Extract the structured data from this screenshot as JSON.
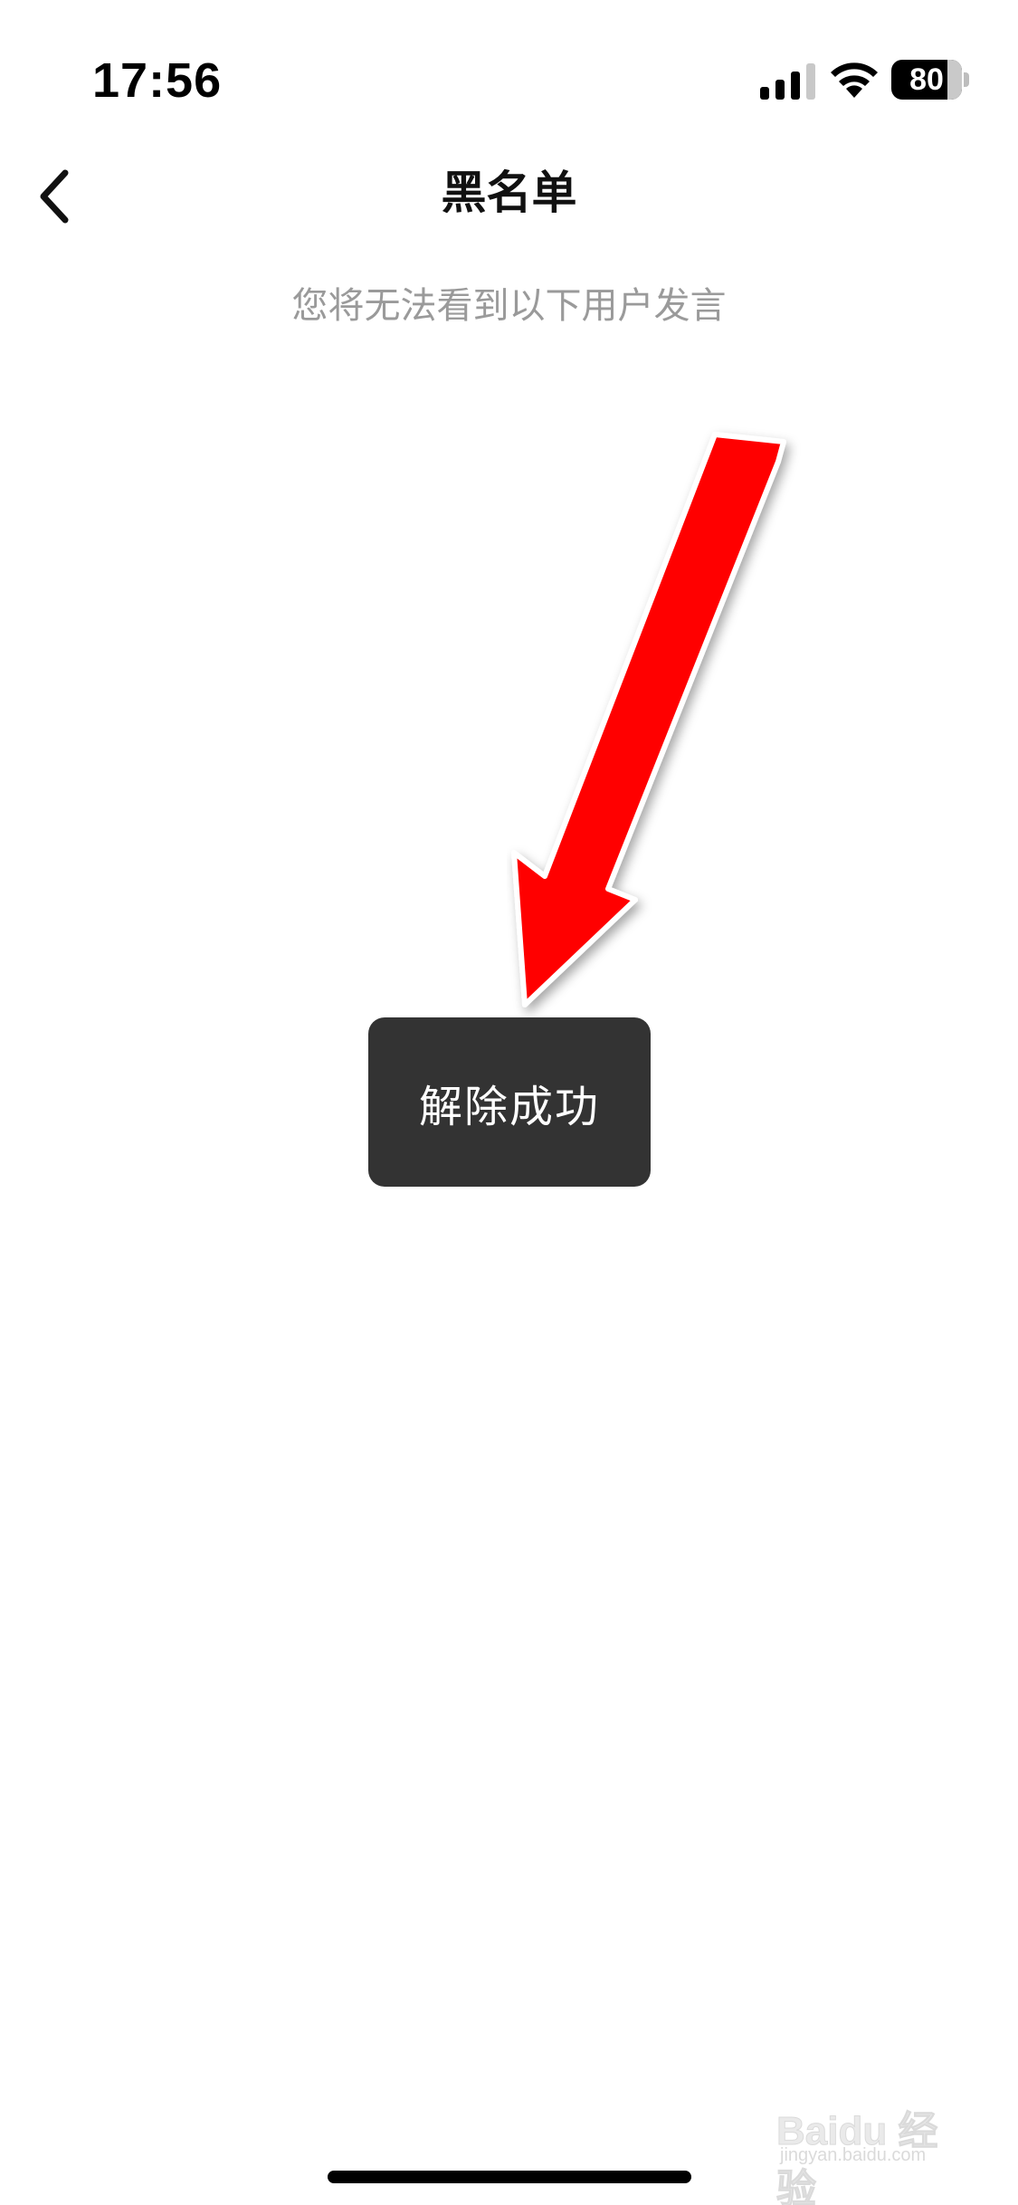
{
  "status_bar": {
    "time": "17:56",
    "battery_level": "80",
    "battery_fraction": 0.8,
    "icons": [
      "signal-icon",
      "wifi-icon",
      "battery-icon"
    ]
  },
  "nav": {
    "back_icon": "chevron-left-icon",
    "title": "黑名单"
  },
  "content": {
    "subtitle": "您将无法看到以下用户发言"
  },
  "toast": {
    "message": "解除成功"
  },
  "annotation": {
    "type": "arrow",
    "color": "#ff0000"
  },
  "watermark": {
    "brand": "Baidu 经验",
    "url": "jingyan.baidu.com"
  }
}
